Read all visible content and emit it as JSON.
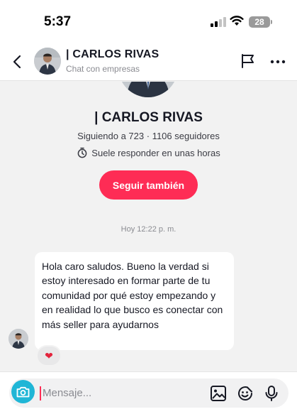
{
  "status_bar": {
    "time": "5:37",
    "battery": "28"
  },
  "header": {
    "name": "| CARLOS RIVAS",
    "subtitle": "Chat con empresas"
  },
  "profile": {
    "name": "| CARLOS RIVAS",
    "stats": "Siguiendo a 723 · 1106 seguidores",
    "response_time": "Suele responder en unas horas",
    "follow_button": "Seguir también"
  },
  "conversation": {
    "timestamp": "Hoy 12:22 p. m.",
    "message_text": "Hola caro saludos. Bueno la verdad si estoy interesado en formar parte de tu comunidad por qué estoy empezando y en realidad lo que busco es conectar con más seller para ayudarnos",
    "reaction": "❤"
  },
  "composer": {
    "placeholder": "Mensaje..."
  },
  "colors": {
    "accent": "#fe2c55",
    "camera": "#20b6d6"
  }
}
